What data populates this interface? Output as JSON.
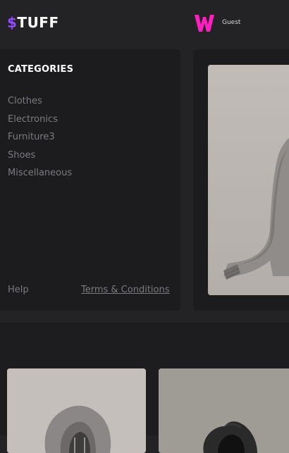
{
  "header": {
    "logo_symbol": "$",
    "logo_text": "TUFF",
    "avatar_letter": "W",
    "user_name": "Guest",
    "accent_color": "#944bff",
    "avatar_color": "#ff1fbf"
  },
  "sidebar": {
    "title": "CATEGORIES",
    "items": [
      {
        "label": "Clothes"
      },
      {
        "label": "Electronics"
      },
      {
        "label": "Furniture3"
      },
      {
        "label": "Shoes"
      },
      {
        "label": "Miscellaneous"
      }
    ],
    "help_label": "Help",
    "terms_label": "Terms & Conditions"
  },
  "banner": {
    "image": "grey-sweatshirt-photo"
  },
  "products": [
    {
      "image": "grey-hoodie-photo"
    },
    {
      "image": "black-hoodie-photo"
    }
  ]
}
